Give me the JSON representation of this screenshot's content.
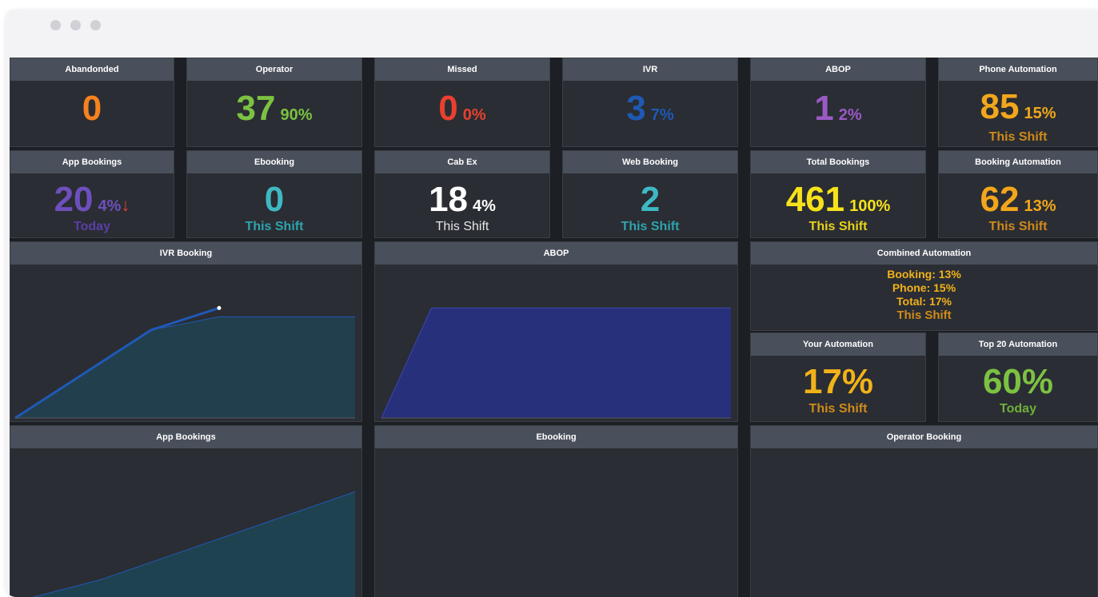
{
  "colors": {
    "orange": "#f5821f",
    "green": "#7cc242",
    "red": "#e8402f",
    "blue": "#1f59b6",
    "purple": "#9b59c6",
    "violet": "#6d4fbd",
    "amber": "#f2a61c",
    "teal": "#3fb8c4",
    "yellow": "#f7e21a",
    "white": "#ffffff"
  },
  "row1": [
    {
      "title": "Abandonded",
      "value": "0",
      "pct": "",
      "sub": ""
    },
    {
      "title": "Operator",
      "value": "37",
      "pct": "90%",
      "sub": ""
    },
    {
      "title": "Missed",
      "value": "0",
      "pct": "0%",
      "sub": ""
    },
    {
      "title": "IVR",
      "value": "3",
      "pct": "7%",
      "sub": ""
    },
    {
      "title": "ABOP",
      "value": "1",
      "pct": "2%",
      "sub": ""
    },
    {
      "title": "Phone Automation",
      "value": "85",
      "pct": "15%",
      "sub": "This Shift"
    }
  ],
  "row2": [
    {
      "title": "App Bookings",
      "value": "20",
      "pct": "4%",
      "sub": "Today",
      "arrow": "↓"
    },
    {
      "title": "Ebooking",
      "value": "0",
      "pct": "",
      "sub": "This Shift"
    },
    {
      "title": "Cab Ex",
      "value": "18",
      "pct": "4%",
      "sub": "This Shift"
    },
    {
      "title": "Web Booking",
      "value": "2",
      "pct": "",
      "sub": "This Shift"
    },
    {
      "title": "Total Bookings",
      "value": "461",
      "pct": "100%",
      "sub": "This Shift"
    },
    {
      "title": "Booking Automation",
      "value": "62",
      "pct": "13%",
      "sub": "This Shift"
    }
  ],
  "combined": {
    "title": "Combined Automation",
    "booking": "Booking: 13%",
    "phone": "Phone: 15%",
    "total": "Total: 17%",
    "sub": "This Shift"
  },
  "your_automation": {
    "title": "Your Automation",
    "value": "17%",
    "sub": "This Shift"
  },
  "top20_automation": {
    "title": "Top 20 Automation",
    "value": "60%",
    "sub": "Today"
  },
  "charts": {
    "ivr_title": "IVR Booking",
    "abop_title": "ABOP",
    "app_title": "App Bookings",
    "ebooking_title": "Ebooking",
    "operator_title": "Operator Booking"
  },
  "chart_data": [
    {
      "type": "area",
      "title": "IVR Booking",
      "x": [
        0,
        1,
        2,
        3,
        4,
        5
      ],
      "series": [
        {
          "values": [
            0,
            1,
            2,
            2.3,
            2.3,
            2.3
          ]
        },
        {
          "values": [
            0,
            1,
            2,
            2.5
          ]
        }
      ]
    },
    {
      "type": "area",
      "title": "ABOP",
      "x": [
        0,
        1,
        2,
        3,
        4,
        5,
        6,
        7
      ],
      "series": [
        {
          "values": [
            0,
            1,
            1,
            1,
            1,
            1,
            1,
            1
          ]
        }
      ]
    },
    {
      "type": "area",
      "title": "App Bookings",
      "x": [
        0,
        1,
        2,
        3,
        4
      ],
      "series": [
        {
          "values": [
            0,
            3,
            7,
            11,
            15
          ]
        }
      ]
    }
  ]
}
